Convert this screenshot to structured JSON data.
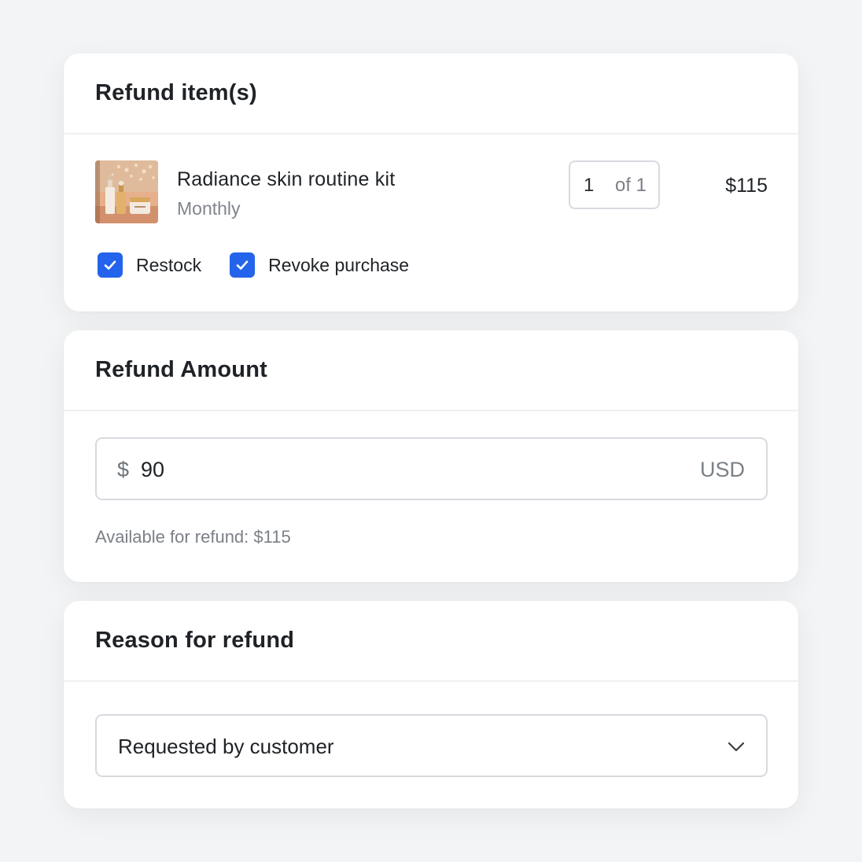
{
  "refund_items": {
    "title": "Refund item(s)",
    "item": {
      "name": "Radiance skin routine kit",
      "subtitle": "Monthly",
      "image_icon": "product-photo-skincare-bottles",
      "quantity": "1",
      "quantity_of": "of 1",
      "price": "$115"
    },
    "options": [
      {
        "label": "Restock",
        "checked": true
      },
      {
        "label": "Revoke purchase",
        "checked": true
      }
    ]
  },
  "refund_amount": {
    "title": "Refund Amount",
    "currency_symbol": "$",
    "value": "90",
    "currency_code": "USD",
    "available_text": "Available for refund: $115"
  },
  "reason": {
    "title": "Reason for refund",
    "selected": "Requested by customer",
    "dropdown_icon": "chevron-down-icon"
  },
  "colors": {
    "background": "#f3f4f5",
    "card": "#ffffff",
    "accent": "#2463eb",
    "border": "#d7dadf",
    "muted_text": "#7b8087"
  }
}
